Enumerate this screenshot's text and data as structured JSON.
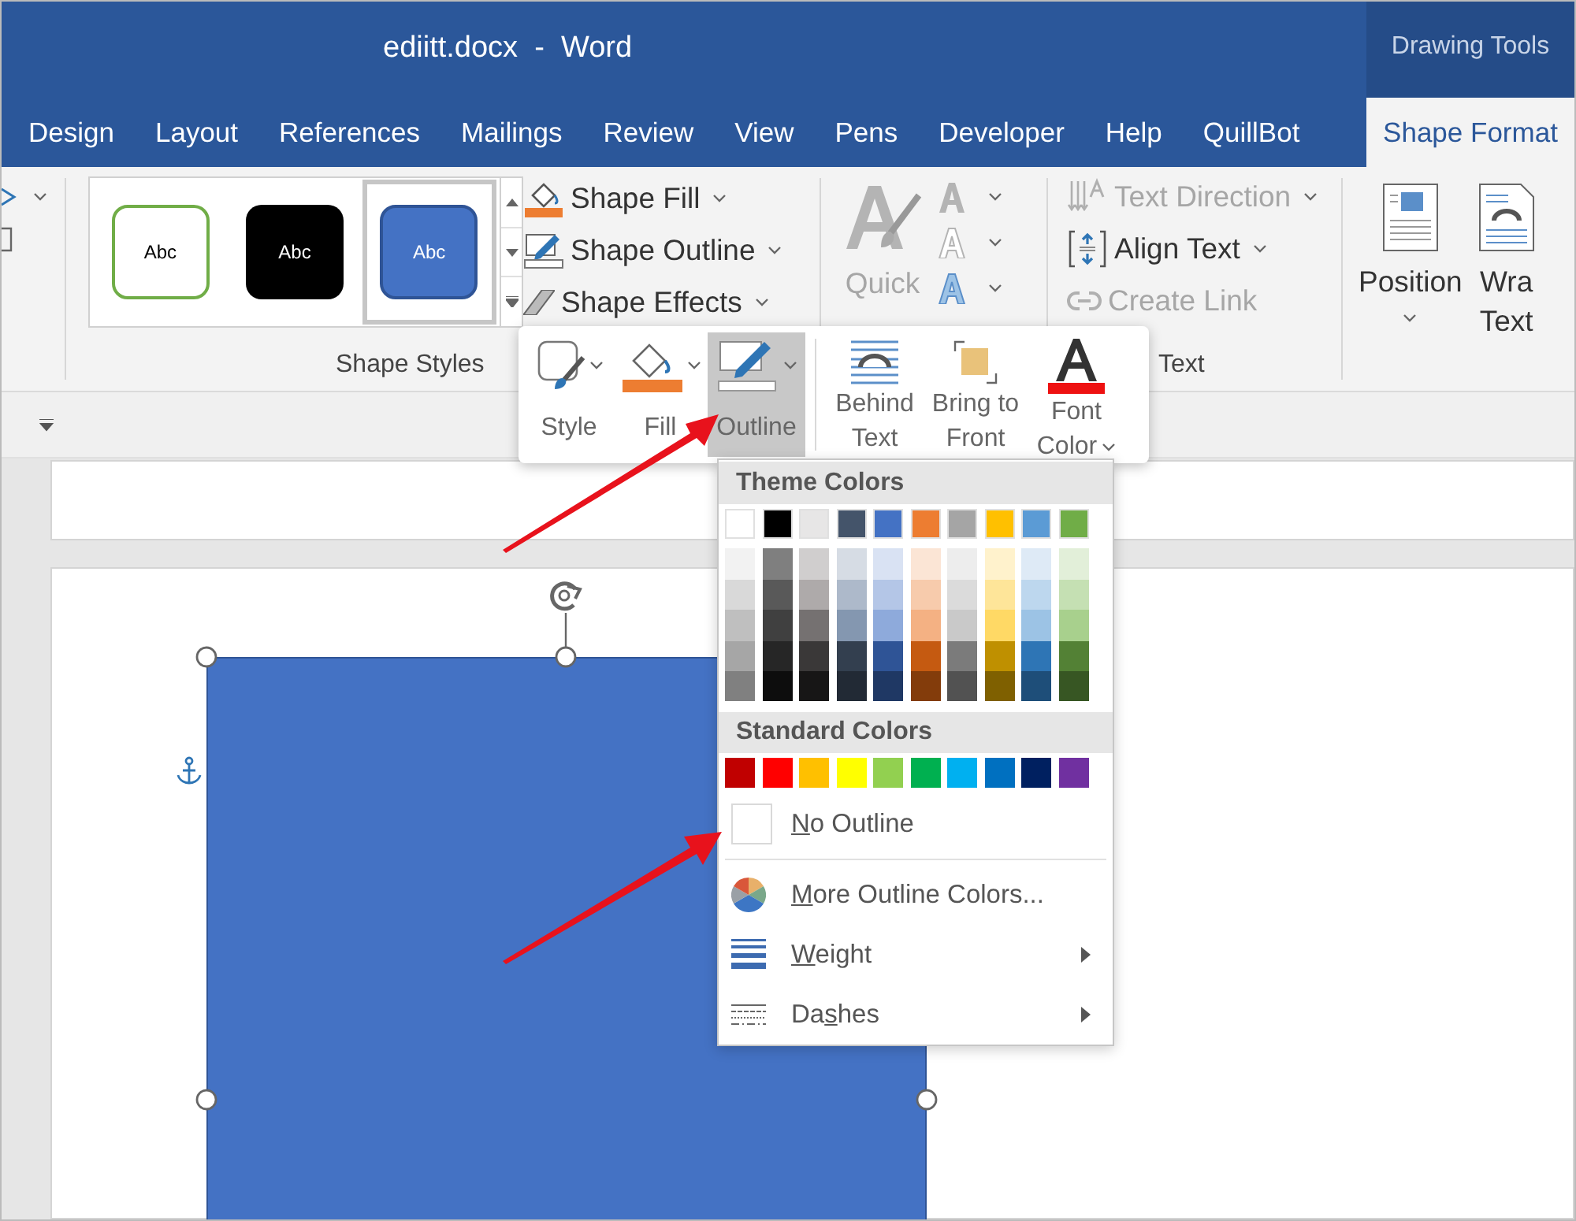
{
  "window": {
    "title": "ediitt.docx  -  Word",
    "context_label": "Drawing Tools"
  },
  "tabs": [
    {
      "label": "Design",
      "selected": false
    },
    {
      "label": "Layout",
      "selected": false
    },
    {
      "label": "References",
      "selected": false
    },
    {
      "label": "Mailings",
      "selected": false
    },
    {
      "label": "Review",
      "selected": false
    },
    {
      "label": "View",
      "selected": false
    },
    {
      "label": "Pens",
      "selected": false
    },
    {
      "label": "Developer",
      "selected": false
    },
    {
      "label": "Help",
      "selected": false
    },
    {
      "label": "QuillBot",
      "selected": false
    },
    {
      "label": "Shape Format",
      "selected": true
    }
  ],
  "shape_styles": {
    "label": "Shape Styles",
    "styles": [
      {
        "kind": "outline",
        "text": "Abc",
        "selected": false
      },
      {
        "kind": "dark",
        "text": "Abc",
        "selected": false
      },
      {
        "kind": "filled",
        "text": "Abc",
        "selected": true
      }
    ]
  },
  "shape_commands": [
    {
      "kind": "fill",
      "label": "Shape Fill"
    },
    {
      "kind": "outline",
      "label": "Shape Outline"
    },
    {
      "kind": "effects",
      "label": "Shape Effects"
    }
  ],
  "wordart": {
    "label": "Quick",
    "disabled": true
  },
  "text_group": {
    "label": "Text",
    "commands": [
      {
        "kind": "direction",
        "label": "Text Direction",
        "disabled": true
      },
      {
        "kind": "align",
        "label": "Align Text",
        "disabled": false
      },
      {
        "kind": "link",
        "label": "Create Link",
        "disabled": true
      }
    ]
  },
  "arrange": [
    {
      "kind": "position",
      "lines": [
        "Position"
      ]
    },
    {
      "kind": "wrap",
      "lines": [
        "Wra",
        "Text"
      ]
    }
  ],
  "mini_toolbar": [
    {
      "kind": "style",
      "lines": [
        "Style"
      ],
      "selected": false
    },
    {
      "kind": "fill",
      "lines": [
        "Fill"
      ],
      "selected": false
    },
    {
      "kind": "outline",
      "lines": [
        "Outline"
      ],
      "selected": true
    },
    {
      "kind": "behind",
      "lines": [
        "Behind",
        "Text"
      ],
      "selected": false
    },
    {
      "kind": "front",
      "lines": [
        "Bring to",
        "Front"
      ],
      "selected": false
    },
    {
      "kind": "font_color",
      "lines": [
        "Font",
        "Color"
      ],
      "selected": false
    }
  ],
  "outline_menu": {
    "theme_title": "Theme Colors",
    "theme_columns": [
      {
        "color": "#ffffff",
        "shades": [
          {
            "color": "#f2f2f2"
          },
          {
            "color": "#d9d9d9"
          },
          {
            "color": "#bfbfbf"
          },
          {
            "color": "#a6a6a6"
          },
          {
            "color": "#808080"
          }
        ]
      },
      {
        "color": "#000000",
        "shades": [
          {
            "color": "#7f7f7f"
          },
          {
            "color": "#595959"
          },
          {
            "color": "#404040"
          },
          {
            "color": "#262626"
          },
          {
            "color": "#0d0d0d"
          }
        ]
      },
      {
        "color": "#e7e6e6",
        "shades": [
          {
            "color": "#d0cece"
          },
          {
            "color": "#aeaaaa"
          },
          {
            "color": "#757171"
          },
          {
            "color": "#3a3838"
          },
          {
            "color": "#171616"
          }
        ]
      },
      {
        "color": "#44546a",
        "shades": [
          {
            "color": "#d6dce4"
          },
          {
            "color": "#adb9ca"
          },
          {
            "color": "#8497b0"
          },
          {
            "color": "#333f4f"
          },
          {
            "color": "#222a35"
          }
        ]
      },
      {
        "color": "#4472c4",
        "shades": [
          {
            "color": "#d9e2f3"
          },
          {
            "color": "#b4c6e7"
          },
          {
            "color": "#8eaadb"
          },
          {
            "color": "#2f5496"
          },
          {
            "color": "#1f3864"
          }
        ]
      },
      {
        "color": "#ed7d31",
        "shades": [
          {
            "color": "#fbe5d5"
          },
          {
            "color": "#f7cbac"
          },
          {
            "color": "#f4b183"
          },
          {
            "color": "#c55a11"
          },
          {
            "color": "#833c0b"
          }
        ]
      },
      {
        "color": "#a5a5a5",
        "shades": [
          {
            "color": "#ededed"
          },
          {
            "color": "#dbdbdb"
          },
          {
            "color": "#c9c9c9"
          },
          {
            "color": "#7b7b7b"
          },
          {
            "color": "#525252"
          }
        ]
      },
      {
        "color": "#ffc000",
        "shades": [
          {
            "color": "#fff2cc"
          },
          {
            "color": "#fee599"
          },
          {
            "color": "#ffd965"
          },
          {
            "color": "#bf9000"
          },
          {
            "color": "#7f6000"
          }
        ]
      },
      {
        "color": "#5b9bd5",
        "shades": [
          {
            "color": "#deeaf6"
          },
          {
            "color": "#bdd7ee"
          },
          {
            "color": "#9cc3e5"
          },
          {
            "color": "#2e75b5"
          },
          {
            "color": "#1e4e79"
          }
        ]
      },
      {
        "color": "#70ad47",
        "shades": [
          {
            "color": "#e2efd9"
          },
          {
            "color": "#c5e0b3"
          },
          {
            "color": "#a8d08d"
          },
          {
            "color": "#538135"
          },
          {
            "color": "#375623"
          }
        ]
      }
    ],
    "standard_title": "Standard Colors",
    "standard_colors": [
      {
        "color": "#c00000"
      },
      {
        "color": "#ff0000"
      },
      {
        "color": "#ffc000"
      },
      {
        "color": "#ffff00"
      },
      {
        "color": "#92d050"
      },
      {
        "color": "#00b050"
      },
      {
        "color": "#00b0f0"
      },
      {
        "color": "#0070c0"
      },
      {
        "color": "#002060"
      },
      {
        "color": "#7030a0"
      }
    ],
    "items": [
      {
        "kind": "no_outline",
        "key": "N",
        "after": "o Outline",
        "submenu": false
      },
      {
        "kind": "more_colors",
        "key": "M",
        "after": "ore Outline Colors...",
        "submenu": false
      },
      {
        "kind": "weight",
        "key": "W",
        "after": "eight",
        "submenu": true
      },
      {
        "kind": "dashes",
        "before": "Da",
        "key": "s",
        "after": "hes",
        "submenu": true
      }
    ]
  }
}
